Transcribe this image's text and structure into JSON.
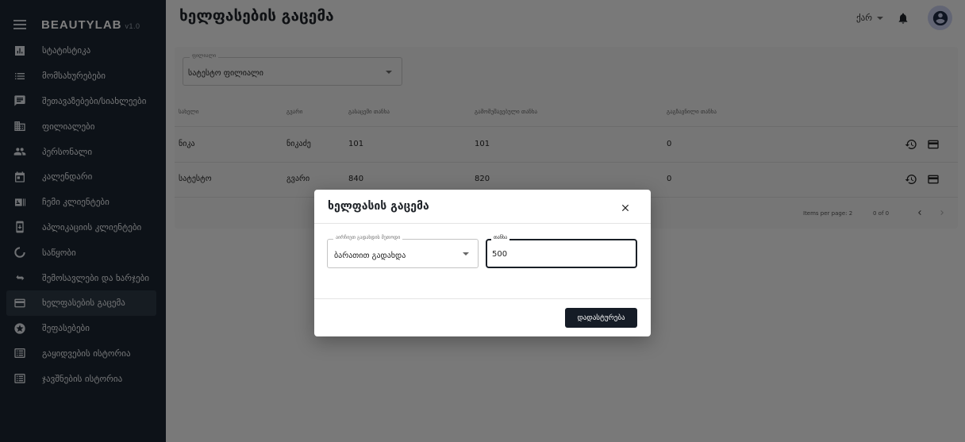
{
  "app": {
    "name": "BEAUTYLAB",
    "version": "v1.0"
  },
  "sidebar": {
    "items": [
      {
        "label": "სტატისტიკა",
        "icon": "bar-chart-icon"
      },
      {
        "label": "მომსახურებები",
        "icon": "list-icon"
      },
      {
        "label": "შეთავაზებები/სიახლეები",
        "icon": "message-icon"
      },
      {
        "label": "ფილიალები",
        "icon": "building-icon"
      },
      {
        "label": "პერსონალი",
        "icon": "people-icon"
      },
      {
        "label": "კალენდარი",
        "icon": "calendar-icon"
      },
      {
        "label": "ჩემი კლიენტები",
        "icon": "contacts-icon"
      },
      {
        "label": "აპლიკაციის კლიენტები",
        "icon": "mobile-download-icon"
      },
      {
        "label": "საწყობი",
        "icon": "circle-notch-icon"
      },
      {
        "label": "შემოსავლები და ხარჯები",
        "icon": "swap-arrows-icon"
      },
      {
        "label": "ხელფასების გაცემა",
        "icon": "credit-card-icon",
        "active": true
      },
      {
        "label": "შეფასებები",
        "icon": "star-badge-icon"
      },
      {
        "label": "გაყიდვების ისტორია",
        "icon": "receipt-list-icon"
      },
      {
        "label": "ჯავშნების ისტორია",
        "icon": "receipt-list-icon"
      }
    ]
  },
  "header": {
    "title": "ხელფასების გაცემა",
    "language": "ქარ"
  },
  "filter": {
    "legend": "ფილიალი",
    "value": "სატესტო ფილიალი"
  },
  "table": {
    "columns": [
      "სახელი",
      "გვარი",
      "გასაცემი თანხა",
      "გამომუშავებული თანხა",
      "გაგზავნილი თანხა"
    ],
    "rows": [
      [
        "ნიკა",
        "ნიკაძე",
        "101",
        "101",
        "0"
      ],
      [
        "სატესტო",
        "გვარი",
        "840",
        "820",
        "0"
      ]
    ]
  },
  "pagination": {
    "items_per_page": "Items per page: 2",
    "range": "0 of 0"
  },
  "dialog": {
    "title": "ხელფასის გაცემა",
    "payment_method_legend": "აირჩიეთ გადახდის მეთოდი",
    "payment_method_value": "ბარათით გადახდა",
    "amount_legend": "თანხა",
    "amount_value": "500",
    "confirm_label": "დადასტურება"
  },
  "colors": {
    "sidebar_bg": "#1a2430",
    "accent_dark": "#151c26",
    "avatar_bg": "#c5cbe8"
  }
}
